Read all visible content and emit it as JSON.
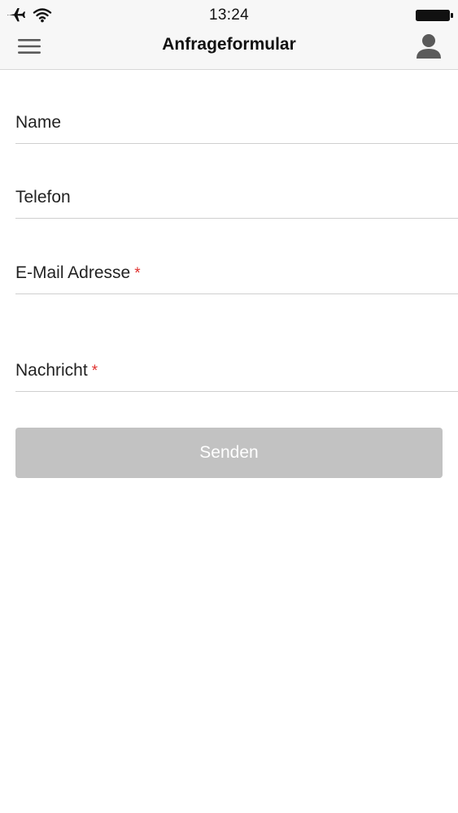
{
  "status_bar": {
    "time": "13:24",
    "icons": [
      "airplane-icon",
      "wifi-icon",
      "battery-icon"
    ]
  },
  "nav_bar": {
    "title": "Anfrageformular",
    "left_icon": "menu-icon",
    "right_icon": "profile-icon"
  },
  "form": {
    "fields": [
      {
        "label": "Name",
        "required": false
      },
      {
        "label": "Telefon",
        "required": false
      },
      {
        "label": "E-Mail Adresse",
        "required": true,
        "required_marker": "*"
      },
      {
        "label": "Nachricht",
        "required": true,
        "required_marker": "*"
      }
    ],
    "submit_label": "Senden"
  },
  "colors": {
    "required_marker": "#e0322f",
    "button_disabled": "#c2c2c2",
    "nav_background": "#f7f7f7"
  }
}
